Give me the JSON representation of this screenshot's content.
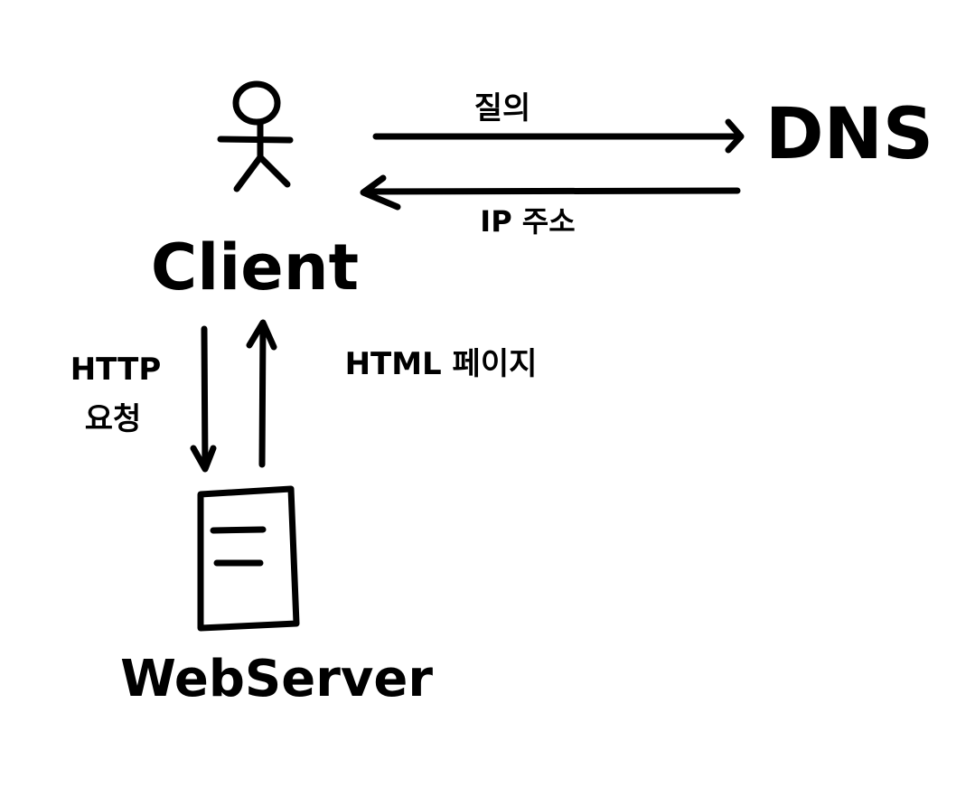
{
  "diagram": {
    "ink_color": "#000000",
    "background_color": "#ffffff",
    "nodes": {
      "client": {
        "label": "Client",
        "icon": "stick-figure-icon"
      },
      "dns": {
        "label": "DNS"
      },
      "web_server": {
        "label": "WebServer",
        "icon": "server-icon"
      }
    },
    "edges": {
      "query": {
        "label": "질의",
        "from": "client",
        "to": "dns"
      },
      "ip_address": {
        "label": "IP 주소",
        "from": "dns",
        "to": "client"
      },
      "http_request": {
        "label_line1": "HTTP",
        "label_line2": "요청",
        "from": "client",
        "to": "web_server"
      },
      "html_page": {
        "label": "HTML 페이지",
        "from": "web_server",
        "to": "client"
      }
    }
  }
}
